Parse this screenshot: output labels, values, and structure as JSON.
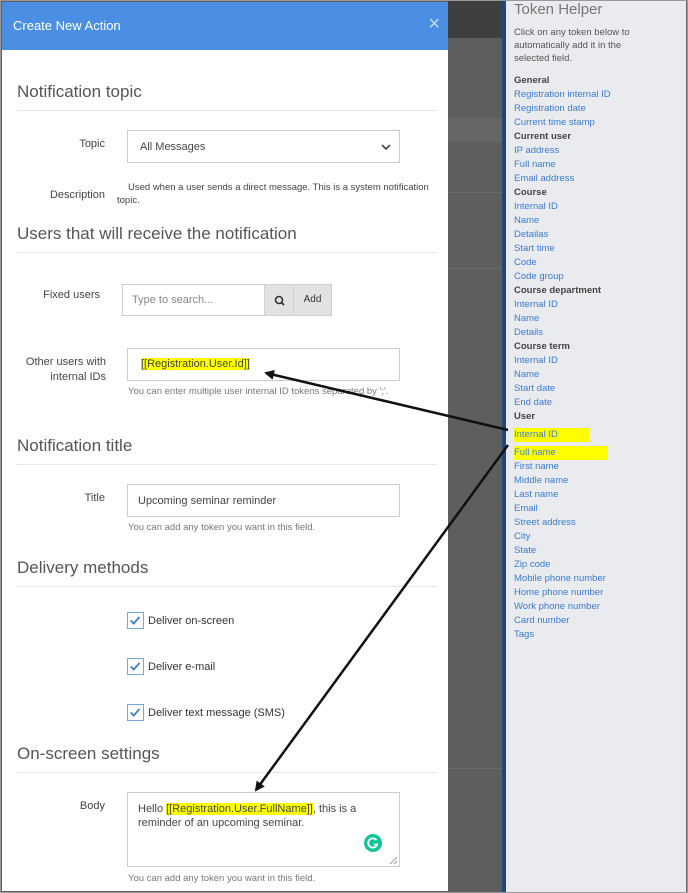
{
  "modal": {
    "title": "Create New Action",
    "close": "×",
    "sections": {
      "topic": "Notification topic",
      "receivers": "Users that will receive the notification",
      "title": "Notification title",
      "delivery": "Delivery methods",
      "onscreen": "On-screen settings"
    },
    "topic": {
      "label": "Topic",
      "value": "All Messages",
      "description_label": "Description",
      "description": "Used when a user sends a direct message. This is a system notification topic."
    },
    "fixed_users": {
      "label": "Fixed users",
      "placeholder": "Type to search...",
      "add": "Add"
    },
    "other_users": {
      "label": "Other users with internal IDs",
      "value": "[[Registration.User.Id]]",
      "help": "You can enter multiple user internal ID tokens separated by ';'."
    },
    "notification_title": {
      "label": "Title",
      "value": "Upcoming seminar reminder",
      "help": "You can add any token you want in this field."
    },
    "delivery": [
      {
        "label": "Deliver on-screen",
        "checked": true
      },
      {
        "label": "Deliver e-mail",
        "checked": true
      },
      {
        "label": "Deliver text message (SMS)",
        "checked": true
      }
    ],
    "body": {
      "label": "Body",
      "prefix": "Hello ",
      "token": "[[Registration.User.FullName]]",
      "suffix": ", this is a reminder of an upcoming seminar.",
      "help": "You can add any token you want in this field."
    }
  },
  "helper": {
    "title": "Token Helper",
    "intro": "Click on any token below to automatically add it in the selected field.",
    "groups": [
      {
        "head": "General",
        "items": [
          "Registration internal ID",
          "Registration date",
          "Current time stamp"
        ]
      },
      {
        "head": "Current user",
        "items": [
          "IP address",
          "Full name",
          "Email address"
        ]
      },
      {
        "head": "Course",
        "items": [
          "Internal ID",
          "Name",
          "Detailas",
          "Start time",
          "Code",
          "Code group"
        ]
      },
      {
        "head": "Course department",
        "items": [
          "Internal ID",
          "Name",
          "Details"
        ]
      },
      {
        "head": "Course term",
        "items": [
          "Internal ID",
          "Name",
          "Start date",
          "End date"
        ]
      },
      {
        "head": "User",
        "items": [
          "Internal ID",
          "Full name",
          "First name",
          "Middle name",
          "Last name",
          "Email",
          "Street address",
          "City",
          "State",
          "Zip code",
          "Mobile phone number",
          "Home phone number",
          "Work phone number",
          "Card number",
          "Tags"
        ]
      }
    ]
  },
  "colors": {
    "header": "#4a8fe4",
    "highlight": "#ffff00",
    "link": "#3a7bd5",
    "divider": "#1c4a7d"
  }
}
